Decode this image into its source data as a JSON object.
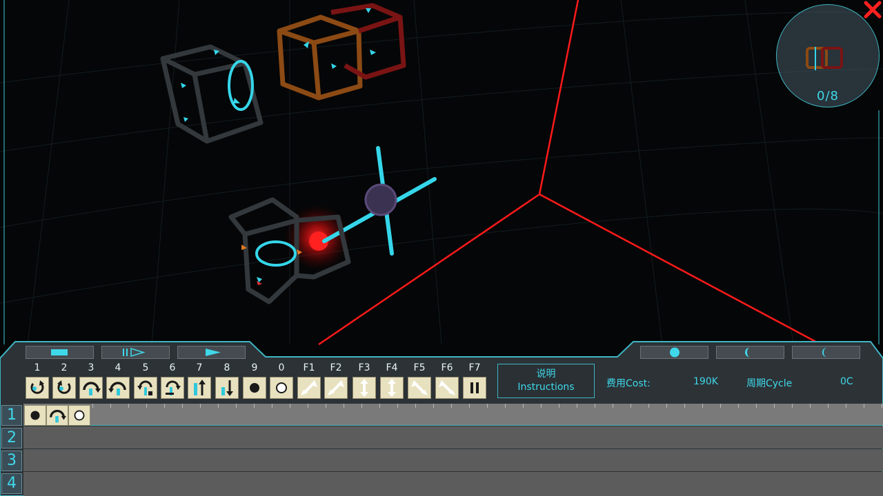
{
  "minimap": {
    "count": "0/8"
  },
  "playback": {
    "buttons": [
      {
        "name": "stop-button",
        "icon": "stop-icon"
      },
      {
        "name": "step-button",
        "icon": "step-icon"
      },
      {
        "name": "play-button",
        "icon": "play-icon"
      }
    ]
  },
  "view_buttons": [
    {
      "name": "view-full-button",
      "icon": "full-circle-icon"
    },
    {
      "name": "view-half-button",
      "icon": "half-moon-icon"
    },
    {
      "name": "view-crescent-button",
      "icon": "crescent-icon"
    }
  ],
  "keys": [
    "1",
    "2",
    "3",
    "4",
    "5",
    "6",
    "7",
    "8",
    "9",
    "0",
    "F1",
    "F2",
    "F3",
    "F4",
    "F5",
    "F6",
    "F7"
  ],
  "instruction_tiles": [
    {
      "name": "rotate-cw-tile",
      "icon": "rotate-cw-icon"
    },
    {
      "name": "rotate-ccw-tile",
      "icon": "rotate-ccw-icon"
    },
    {
      "name": "pivot-cw-tile",
      "icon": "pivot-cw-icon"
    },
    {
      "name": "pivot-ccw-tile",
      "icon": "pivot-ccw-icon"
    },
    {
      "name": "grab-pivot-cw-tile",
      "icon": "grab-pivot-cw-icon"
    },
    {
      "name": "grab-pivot-ccw-tile",
      "icon": "grab-pivot-ccw-icon"
    },
    {
      "name": "extend-up-tile",
      "icon": "extend-up-icon"
    },
    {
      "name": "retract-down-tile",
      "icon": "retract-down-icon"
    },
    {
      "name": "grab-tile",
      "icon": "filled-circle-icon"
    },
    {
      "name": "drop-tile",
      "icon": "empty-circle-icon"
    },
    {
      "name": "diag-ne-sw-tile",
      "icon": "diagonal-arrow-icon"
    },
    {
      "name": "diag-sw-ne-tile",
      "icon": "diagonal-arrow-icon"
    },
    {
      "name": "vertical-arrow-tile",
      "icon": "vertical-arrow-icon"
    },
    {
      "name": "vertical-arrow-2-tile",
      "icon": "vertical-arrow-icon"
    },
    {
      "name": "diag-nw-se-tile",
      "icon": "diagonal-arrow-icon"
    },
    {
      "name": "diag-se-nw-tile",
      "icon": "diagonal-arrow-icon"
    },
    {
      "name": "pause-tile",
      "icon": "pause-icon"
    }
  ],
  "instructions": {
    "label_cn": "说明",
    "label_en": "Instructions"
  },
  "stats": {
    "cost_label": "费用Cost:",
    "cost_value": "190K",
    "cycle_label": "周期Cycle",
    "cycle_value": "0C"
  },
  "program_rows": [
    {
      "num": "1",
      "tiles": [
        "filled-circle-icon",
        "pivot-cw-icon",
        "empty-circle-icon"
      ]
    },
    {
      "num": "2",
      "tiles": []
    },
    {
      "num": "3",
      "tiles": []
    },
    {
      "num": "4",
      "tiles": []
    }
  ],
  "colors": {
    "accent": "#3fd8ea",
    "red": "#ff2020",
    "tile": "#e8e1bf"
  }
}
